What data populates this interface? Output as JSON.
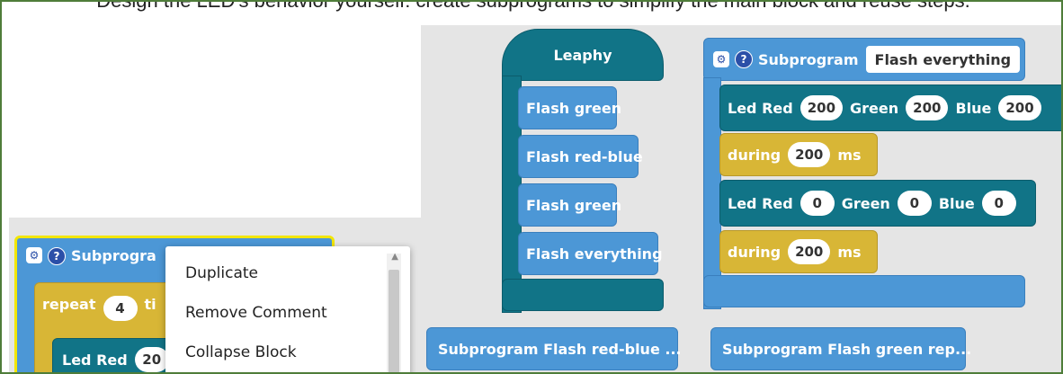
{
  "caption": "Design the LED's behavior yourself: create subprograms to simplify the main block and reuse steps.",
  "main_block": {
    "title": "Leaphy",
    "calls": [
      "Flash green",
      "Flash red-blue",
      "Flash green",
      "Flash everything"
    ]
  },
  "sub_flash_everything": {
    "label": "Subprogram",
    "name": "Flash everything",
    "led1": {
      "led": "Led",
      "red": "Red",
      "red_v": "200",
      "green": "Green",
      "green_v": "200",
      "blue": "Blue",
      "blue_v": "200"
    },
    "during1": {
      "during": "during",
      "value": "200",
      "unit": "ms"
    },
    "led2": {
      "led": "Led",
      "red": "Red",
      "red_v": "0",
      "green": "Green",
      "green_v": "0",
      "blue": "Blue",
      "blue_v": "0"
    },
    "during2": {
      "during": "during",
      "value": "200",
      "unit": "ms"
    }
  },
  "collapsed": {
    "red_blue": "Subprogram Flash red-blue ...",
    "green_rep": "Subprogram Flash green rep..."
  },
  "lower_block": {
    "label": "Subprogra",
    "repeat": "repeat",
    "repeat_v": "4",
    "times": "ti",
    "led": "Led",
    "red": "Red",
    "red_v": "20"
  },
  "context_menu": {
    "items": [
      "Duplicate",
      "Remove Comment",
      "Collapse Block"
    ]
  },
  "colors": {
    "subprogram": "#4c97d6",
    "led": "#117487",
    "wait": "#d8b636",
    "selected": "#f2e600"
  },
  "icons": {
    "gear": "gear-icon",
    "help": "help-icon"
  }
}
